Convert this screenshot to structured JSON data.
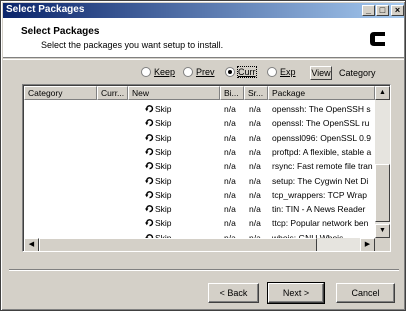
{
  "window": {
    "title": "Select Packages",
    "controls": {
      "minimize": "_",
      "maximize": "□",
      "close": "×"
    }
  },
  "header": {
    "title": "Select Packages",
    "subtitle": "Select the packages you want setup to install."
  },
  "view_options": {
    "radios": [
      {
        "label": "Keep",
        "selected": false
      },
      {
        "label": "Prev",
        "selected": false
      },
      {
        "label": "Curr",
        "selected": true
      },
      {
        "label": "Exp",
        "selected": false
      }
    ],
    "view_button": "View",
    "view_mode": "Category"
  },
  "table": {
    "columns": [
      "Category",
      "Curr...",
      "New",
      "Bi...",
      "Sr...",
      "Package"
    ],
    "rows": [
      {
        "new": "Skip",
        "bin": "n/a",
        "src": "n/a",
        "package": "openssh: The OpenSSH s"
      },
      {
        "new": "Skip",
        "bin": "n/a",
        "src": "n/a",
        "package": "openssl: The OpenSSL ru"
      },
      {
        "new": "Skip",
        "bin": "n/a",
        "src": "n/a",
        "package": "openssl096: OpenSSL 0.9"
      },
      {
        "new": "Skip",
        "bin": "n/a",
        "src": "n/a",
        "package": "proftpd: A flexible, stable a"
      },
      {
        "new": "Skip",
        "bin": "n/a",
        "src": "n/a",
        "package": "rsync: Fast remote file tran"
      },
      {
        "new": "Skip",
        "bin": "n/a",
        "src": "n/a",
        "package": "setup: The Cygwin Net Di"
      },
      {
        "new": "Skip",
        "bin": "n/a",
        "src": "n/a",
        "package": "tcp_wrappers: TCP Wrap"
      },
      {
        "new": "Skip",
        "bin": "n/a",
        "src": "n/a",
        "package": "tin: TIN - A News Reader"
      },
      {
        "new": "Skip",
        "bin": "n/a",
        "src": "n/a",
        "package": "ttcp: Popular network ben"
      },
      {
        "new": "Skip",
        "bin": "n/a",
        "src": "n/a",
        "package": "whois: GNU Whois"
      }
    ]
  },
  "buttons": {
    "back": "< Back",
    "next": "Next >",
    "cancel": "Cancel"
  },
  "colors": {
    "title_start": "#0a246a",
    "title_end": "#a6caf0",
    "face": "#d4d0c8"
  }
}
